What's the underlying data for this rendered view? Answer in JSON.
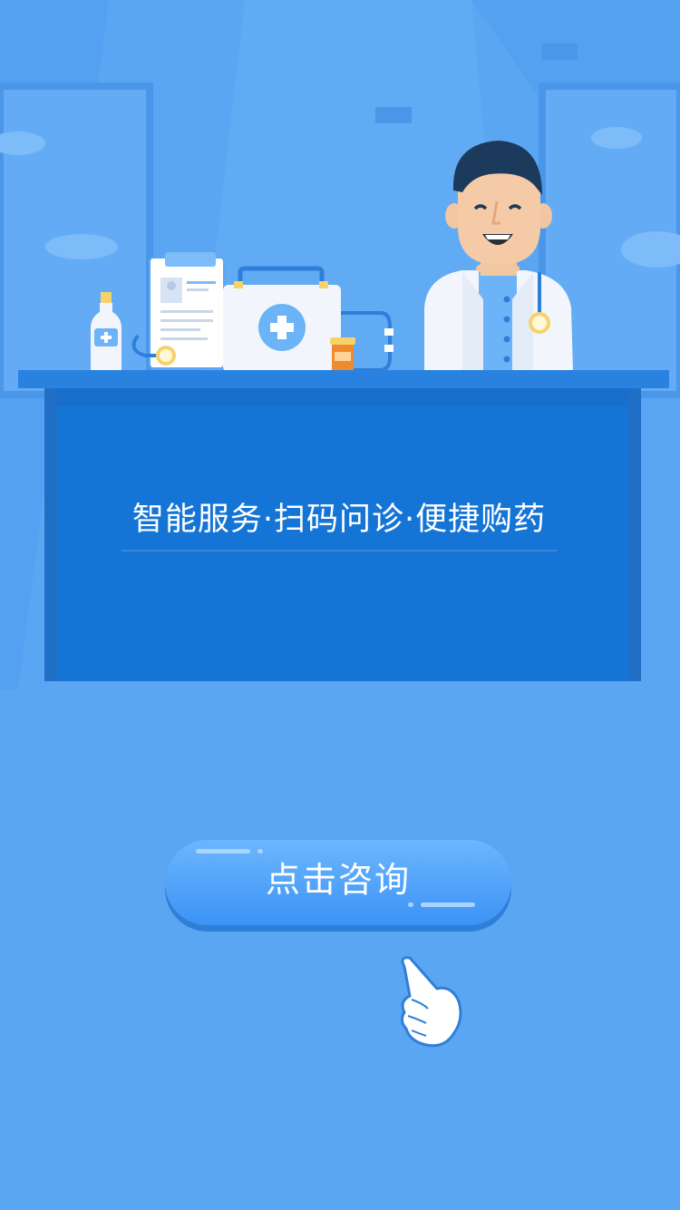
{
  "banner": {
    "headline": "智能服务·扫码问诊·便捷购药"
  },
  "consult_button": {
    "label": "点击咨询"
  },
  "colors": {
    "background": "#5aa6f2",
    "desk_front": "#1575d6",
    "desk_top": "#2a82e0",
    "button": "#4aa0f8",
    "doctor_coat": "#f2f6fc"
  },
  "icons": [
    "doctor-illustration",
    "first-aid-kit-icon",
    "clipboard-icon",
    "medicine-bottle-icon",
    "pill-bottle-icon",
    "stethoscope-icon",
    "pointing-hand-icon"
  ]
}
